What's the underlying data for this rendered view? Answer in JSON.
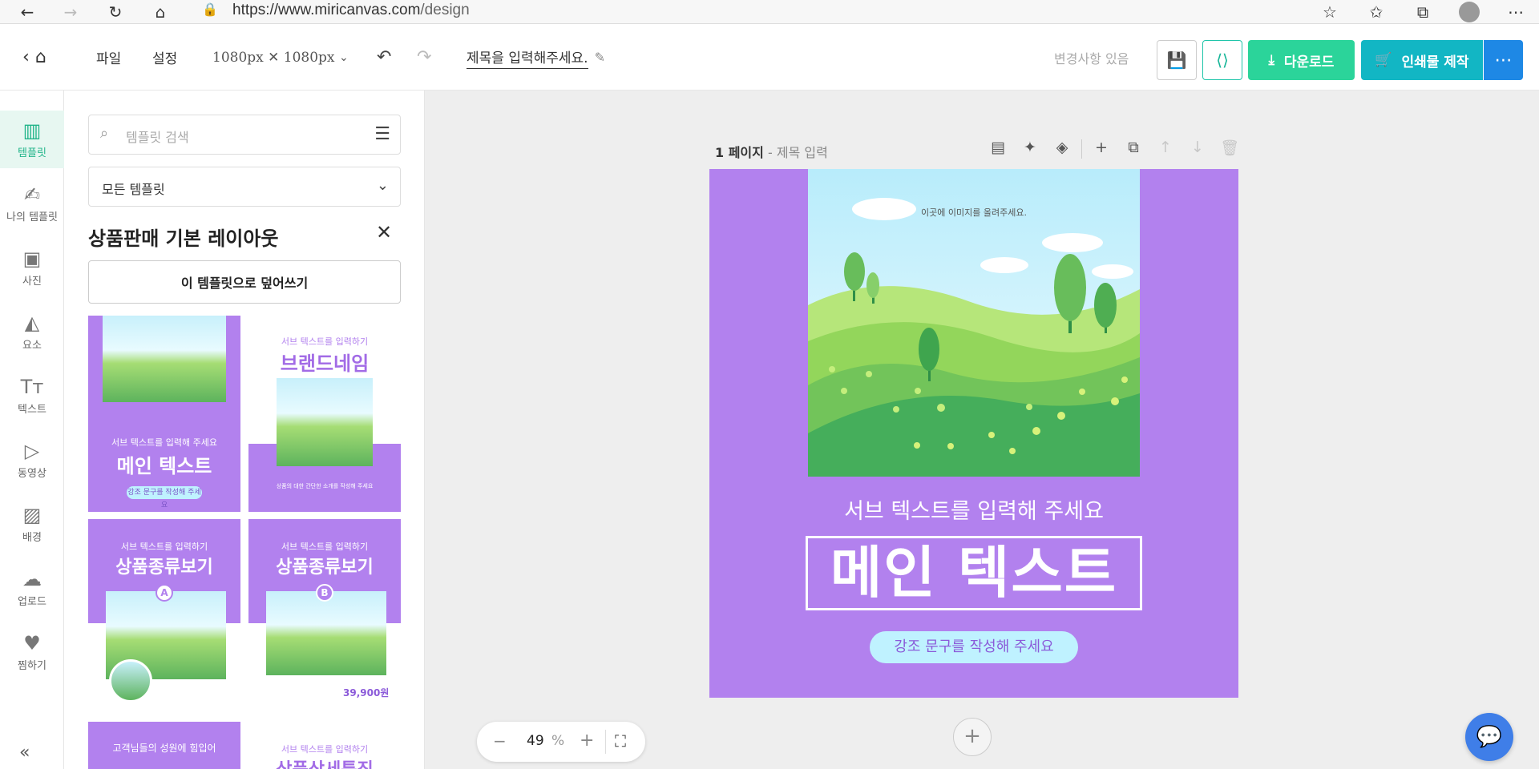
{
  "browser": {
    "url_host": "https://www.miricanvas.com",
    "url_path": "/design",
    "icons": [
      "back-icon",
      "forward-icon",
      "refresh-icon",
      "home-icon",
      "lock-icon",
      "star-add-icon",
      "favorites-icon",
      "collections-icon",
      "profile-icon",
      "more-icon"
    ]
  },
  "header": {
    "file": "파일",
    "settings": "설정",
    "size": "1080px ✕ 1080px",
    "title": "제목을 입력해주세요.",
    "changes": "변경사항 있음",
    "download": "다운로드",
    "print": "인쇄물 제작",
    "colors": {
      "download": "#2bd49a",
      "print": "#12b6c4",
      "more": "#1e88e5",
      "share": "#15b597"
    }
  },
  "rail": {
    "items": [
      {
        "label": "템플릿",
        "icon": "template-icon",
        "active": true
      },
      {
        "label": "나의 템플릿",
        "icon": "my-template-icon"
      },
      {
        "label": "사진",
        "icon": "photo-icon"
      },
      {
        "label": "요소",
        "icon": "elements-icon"
      },
      {
        "label": "텍스트",
        "icon": "text-icon"
      },
      {
        "label": "동영상",
        "icon": "video-icon"
      },
      {
        "label": "배경",
        "icon": "background-icon"
      },
      {
        "label": "업로드",
        "icon": "upload-icon"
      },
      {
        "label": "찜하기",
        "icon": "heart-icon"
      }
    ],
    "active_color": "#22b58a"
  },
  "panel": {
    "search_placeholder": "템플릿 검색",
    "category": "모든 템플릿",
    "section_title": "상품판매 기본 레이아웃",
    "overwrite": "이 템플릿으로 덮어쓰기",
    "thumbs": [
      {
        "sub": "서브 텍스트를 입력해 주세요",
        "big": "메인 텍스트",
        "pill": "강조 문구를 작성해 주세요"
      },
      {
        "sub": "서브 텍스트를 입력하기",
        "big": "브랜드네임",
        "foot": "상품의 대한 간단한 소개를 작성해 주세요"
      },
      {
        "sub": "서브 텍스트를 입력하기",
        "big": "상품종류보기",
        "badge": "A"
      },
      {
        "sub": "서브 텍스트를 입력하기",
        "big": "상품종류보기",
        "badge": "B",
        "price": "39,900원"
      },
      {
        "sub": "고객님들의 성원에 힘입어"
      },
      {
        "sub": "서브 텍스트를 입력하기",
        "big": "상품상세특징"
      }
    ]
  },
  "workspace": {
    "page_number": "1 페이지",
    "page_title": "제목 입력",
    "canvas_color": "#b281ee",
    "upload_hint": "이곳에 이미지를 올려주세요.",
    "sub_text": "서브 텍스트를 입력해 주세요",
    "main_text": "메인 텍스트",
    "emphasis": "강조 문구를 작성해 주세요",
    "zoom": "49",
    "zoom_unit": "%"
  }
}
